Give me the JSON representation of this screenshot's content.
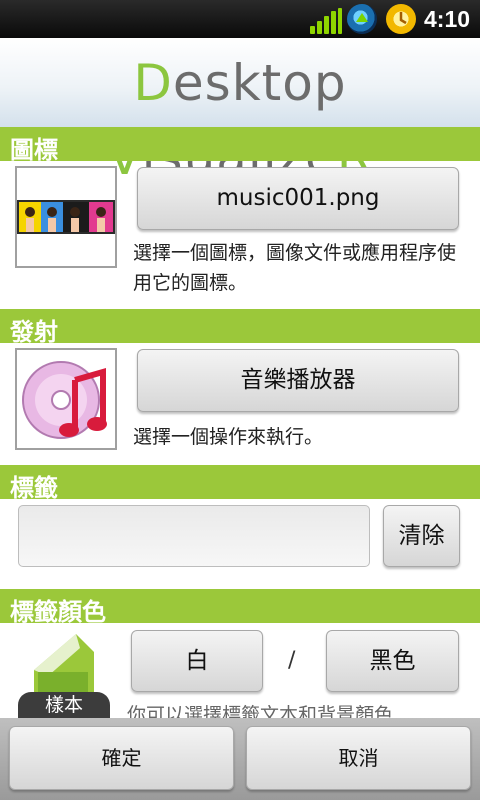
{
  "status_bar": {
    "time": "4:10"
  },
  "header": {
    "logo_parts": [
      "D",
      "esktop ",
      "V",
      "isualize",
      "R"
    ]
  },
  "icon_section": {
    "title": "圖標",
    "file_button_label": "music001.png",
    "description": "選擇一個圖標，圖像文件或應用程序使用它的圖標。"
  },
  "launch_section": {
    "title": "發射",
    "action_button_label": "音樂播放器",
    "description": "選擇一個操作來執行。"
  },
  "label_section": {
    "title": "標籤",
    "input_value": "",
    "clear_button_label": "清除"
  },
  "label_color_section": {
    "title": "標籤顏色",
    "sample_label": "樣本",
    "text_color_button_label": "白",
    "separator": "/",
    "bg_color_button_label": "黑色",
    "description": "你可以選擇標籤文本和背景顏色"
  },
  "footer": {
    "ok_label": "確定",
    "cancel_label": "取消"
  },
  "colors": {
    "accent_green": "#9bc83a",
    "logo_green": "#8cc63f",
    "logo_gray": "#6c6c6c"
  }
}
